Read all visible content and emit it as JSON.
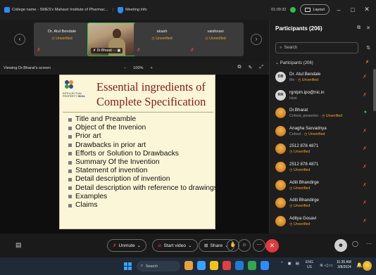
{
  "window": {
    "app_title": "College name - SMES's Mahavir Institute of Pharmac...",
    "meeting_info": "Meeting info",
    "elapsed": "01:09:32",
    "layout_label": "Layout",
    "minimize": "–",
    "maximize": "□",
    "close": "✕"
  },
  "strip": {
    "prev": "‹",
    "next": "›",
    "tiles": [
      {
        "name": "Dr. Atul Bendale",
        "status": "Unverified"
      },
      {
        "video_label": "Dr.Bharat"
      },
      {
        "name": "akash",
        "status": "Unverified"
      },
      {
        "name": "vaishnavi",
        "status": "Unverified"
      }
    ]
  },
  "view": {
    "label": "Viewing Dr.Bharat's screen",
    "zoom_out": "–",
    "zoom": "100%",
    "zoom_in": "+"
  },
  "slide": {
    "logo_line1": "INTELLECTUAL",
    "logo_line2": "PROPERTY",
    "logo_brand": "INDIA",
    "title_line1": "Essential ingredients of",
    "title_line2": "Complete Specification",
    "bullets": [
      "Title and Preamble",
      "Object of the Invenion",
      "Prior art",
      "Drawbacks in prior art",
      "Efforts or Solution to Drawbacks",
      "Summary Of the Invention",
      "Statement of invention",
      "Detail description of invention",
      "Detail description with reference to drawings",
      "Examples",
      "Claims"
    ]
  },
  "panel": {
    "title": "Participants (206)",
    "search_placeholder": "Search",
    "group_label": "Participants (206)",
    "participants": [
      {
        "initials": "DB",
        "name": "Dr. Atul Bendale",
        "role": "Me · ",
        "status": "Unverified",
        "mic": "muted"
      },
      {
        "initials": "RR",
        "name": "rgnipm.ipo@nic.in",
        "role": "Host",
        "status": "",
        "mic": "muted"
      },
      {
        "initials": "",
        "name": "Dr.Bharat",
        "role": "Cohost, presenter · ",
        "status": "Unverified",
        "mic": "on"
      },
      {
        "initials": "",
        "name": "Anagha Sarvadnya",
        "role": "Cohost · ",
        "status": "Unverified",
        "mic": "muted"
      },
      {
        "initials": "",
        "name": "2512 878 4871",
        "role": "",
        "status": "Unverified",
        "mic": "muted"
      },
      {
        "initials": "",
        "name": "2512 878 4871",
        "role": "",
        "status": "Unverified",
        "mic": "muted"
      },
      {
        "initials": "",
        "name": "Aditi Bhandirge",
        "role": "",
        "status": "Unverified",
        "mic": "muted"
      },
      {
        "initials": "",
        "name": "Aditi Bhandirge",
        "role": "",
        "status": "Unverified",
        "mic": "muted"
      },
      {
        "initials": "",
        "name": "Aditya Gosavi",
        "role": "",
        "status": "Unverified",
        "mic": "muted"
      }
    ]
  },
  "controls": {
    "unmute": "Unmute",
    "start_video": "Start video",
    "share": "Share"
  },
  "taskbar": {
    "search": "Search",
    "lang_line1": "ENG",
    "lang_line2": "US",
    "time": "11:35 AM",
    "date": "3/8/2024"
  }
}
